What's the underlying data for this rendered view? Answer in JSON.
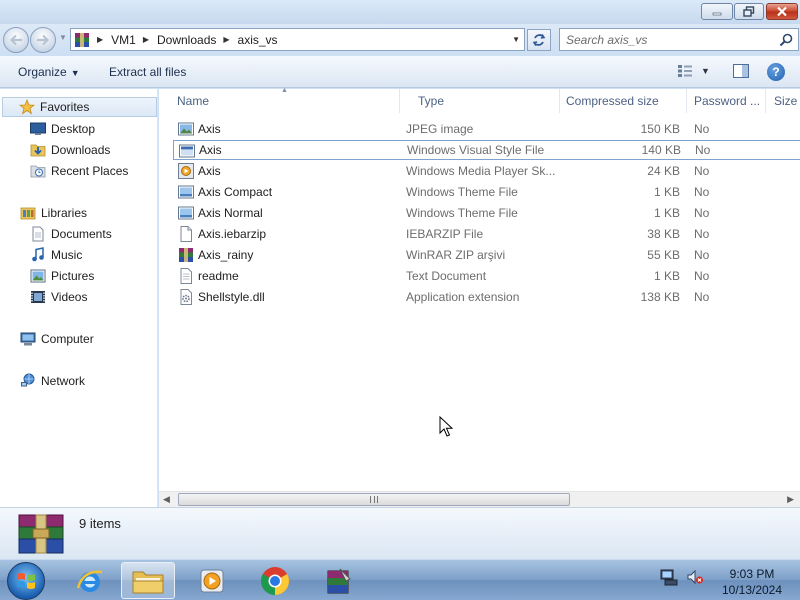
{
  "window": {
    "controls": [
      "minimize",
      "maximize",
      "close"
    ]
  },
  "address": {
    "crumbs": [
      "VM1",
      "Downloads",
      "axis_vs"
    ]
  },
  "search": {
    "placeholder": "Search axis_vs"
  },
  "toolbar": {
    "organize_label": "Organize",
    "extract_label": "Extract all files"
  },
  "sidebar": {
    "favorites_label": "Favorites",
    "favorites": [
      "Desktop",
      "Downloads",
      "Recent Places"
    ],
    "libraries_label": "Libraries",
    "libraries": [
      "Documents",
      "Music",
      "Pictures",
      "Videos"
    ],
    "computer_label": "Computer",
    "network_label": "Network"
  },
  "columns": [
    "Name",
    "Type",
    "Compressed size",
    "Password ...",
    "Size"
  ],
  "files": [
    {
      "name": "Axis",
      "type": "JPEG image",
      "size": "150 KB",
      "password": "No",
      "icon": "image-file-icon"
    },
    {
      "name": "Axis",
      "type": "Windows Visual Style File",
      "size": "140 KB",
      "password": "No",
      "icon": "visual-style-file-icon",
      "selected": true
    },
    {
      "name": "Axis",
      "type": "Windows Media Player Sk...",
      "size": "24 KB",
      "password": "No",
      "icon": "media-player-skin-icon"
    },
    {
      "name": "Axis Compact",
      "type": "Windows Theme File",
      "size": "1 KB",
      "password": "No",
      "icon": "theme-file-icon"
    },
    {
      "name": "Axis Normal",
      "type": "Windows Theme File",
      "size": "1 KB",
      "password": "No",
      "icon": "theme-file-icon"
    },
    {
      "name": "Axis.iebarzip",
      "type": "IEBARZIP File",
      "size": "38 KB",
      "password": "No",
      "icon": "generic-file-icon"
    },
    {
      "name": "Axis_rainy",
      "type": "WinRAR ZIP arşivi",
      "size": "55 KB",
      "password": "No",
      "icon": "winrar-archive-icon"
    },
    {
      "name": "readme",
      "type": "Text Document",
      "size": "1 KB",
      "password": "No",
      "icon": "text-file-icon"
    },
    {
      "name": "Shellstyle.dll",
      "type": "Application extension",
      "size": "138 KB",
      "password": "No",
      "icon": "dll-file-icon"
    }
  ],
  "details": {
    "item_count": "9 items"
  },
  "taskbar": {
    "apps": [
      "internet-explorer",
      "windows-explorer",
      "windows-media-player",
      "chrome",
      "winrar"
    ],
    "time": "9:03 PM",
    "date": "10/13/2024"
  },
  "colors": {
    "accent": "#1d5fb0",
    "selection_border": "#7da2ce",
    "close_button": "#c7442b"
  }
}
